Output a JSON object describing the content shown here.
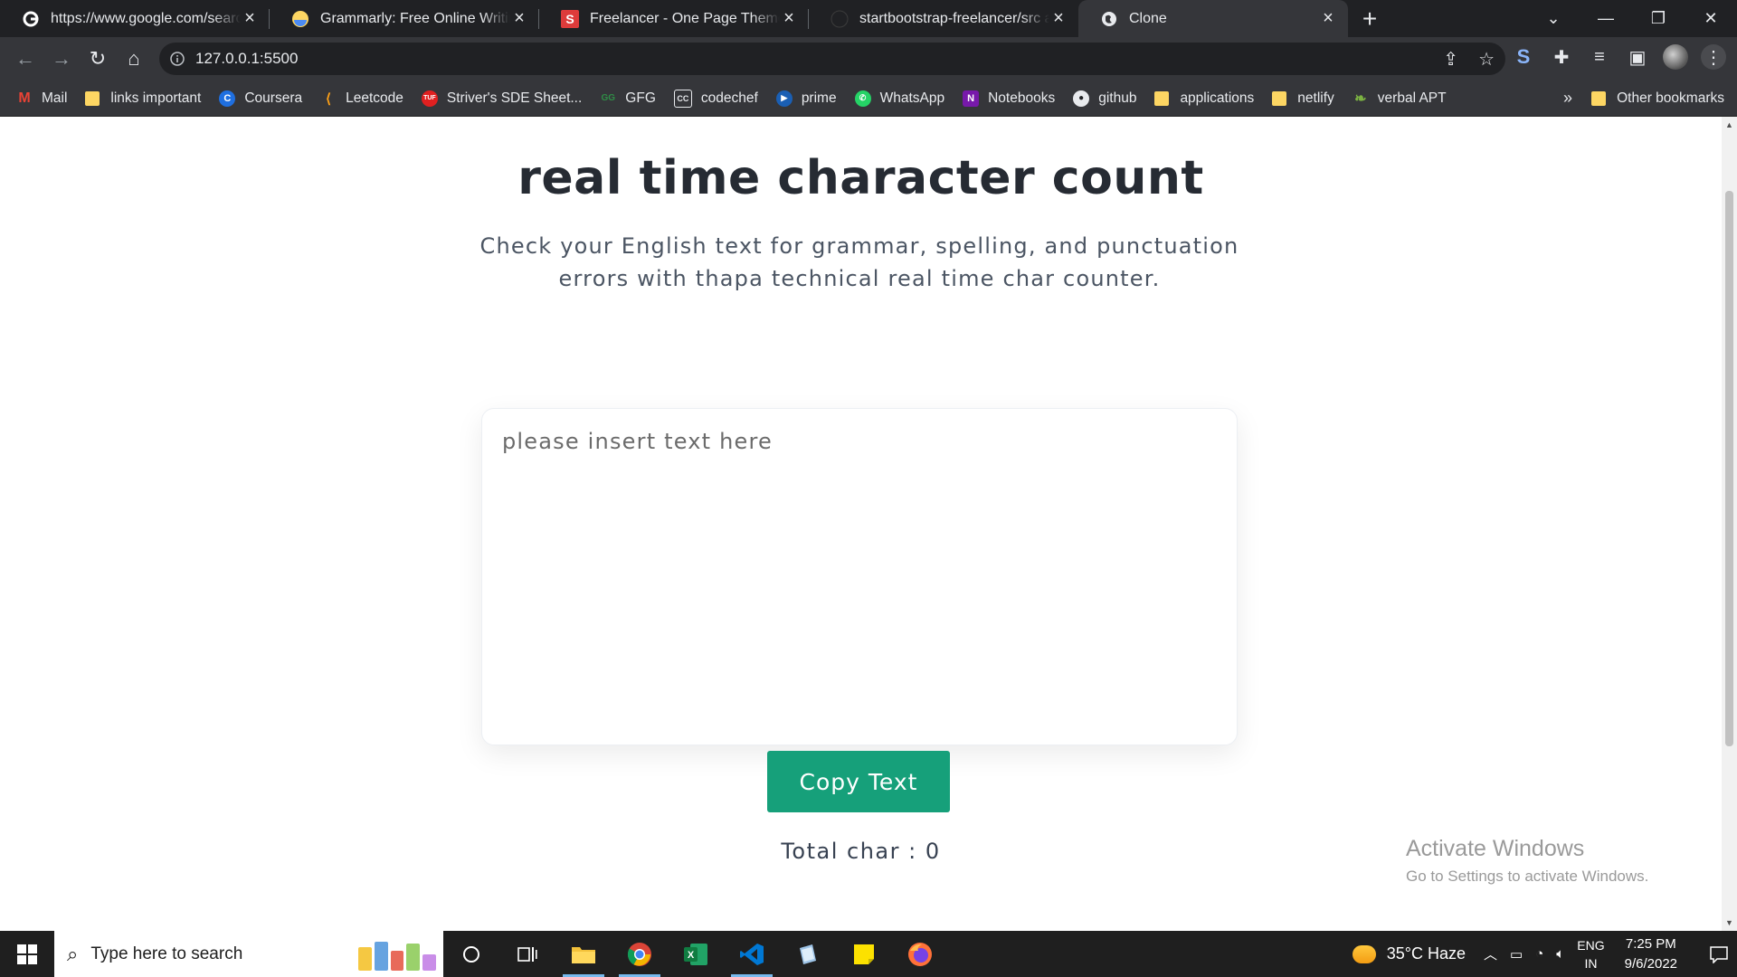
{
  "browser": {
    "tabs": [
      {
        "title": "https://www.google.com/search?",
        "icon": "google-icon",
        "active": false
      },
      {
        "title": "Grammarly: Free Online Writing A",
        "icon": "grammarly-icon",
        "active": false
      },
      {
        "title": "Freelancer - One Page Theme - S",
        "icon": "startbootstrap-icon",
        "active": false
      },
      {
        "title": "startbootstrap-freelancer/src at m",
        "icon": "github-icon",
        "active": false
      },
      {
        "title": "Clone",
        "icon": "globe-icon",
        "active": true
      }
    ],
    "address": "127.0.0.1:5500",
    "bookmarks": [
      {
        "label": "Mail",
        "icon": "gmail-icon"
      },
      {
        "label": "links important",
        "icon": "folder-icon"
      },
      {
        "label": "Coursera",
        "icon": "coursera-icon"
      },
      {
        "label": "Leetcode",
        "icon": "leetcode-icon"
      },
      {
        "label": "Striver's SDE Sheet...",
        "icon": "tuf-icon"
      },
      {
        "label": "GFG",
        "icon": "gfg-icon"
      },
      {
        "label": "codechef",
        "icon": "codechef-icon"
      },
      {
        "label": "prime",
        "icon": "prime-icon"
      },
      {
        "label": "WhatsApp",
        "icon": "whatsapp-icon"
      },
      {
        "label": "Notebooks",
        "icon": "onenote-icon"
      },
      {
        "label": "github",
        "icon": "github-icon"
      },
      {
        "label": "applications",
        "icon": "folder-icon"
      },
      {
        "label": "netlify",
        "icon": "folder-icon"
      },
      {
        "label": "verbal APT",
        "icon": "leaf-icon"
      }
    ],
    "more_bookmarks": "»",
    "other_bookmarks": "Other bookmarks"
  },
  "page": {
    "title": "real time character count",
    "subtitle": "Check your English text for grammar, spelling, and punctuation errors with thapa technical real time char counter.",
    "textarea_placeholder": "please insert text here",
    "textarea_value": "",
    "copy_button": "Copy Text",
    "counter_label": "Total char : ",
    "counter_value": "0"
  },
  "watermark": {
    "line1": "Activate Windows",
    "line2": "Go to Settings to activate Windows."
  },
  "taskbar": {
    "search_placeholder": "Type here to search",
    "weather": "35°C  Haze",
    "lang_top": "ENG",
    "lang_bottom": "IN",
    "time": "7:25 PM",
    "date": "9/6/2022"
  },
  "colors": {
    "accent_button": "#16a07a",
    "title_text": "#262b33",
    "chrome_dark": "#202124",
    "chrome_toolbar": "#35363a"
  }
}
